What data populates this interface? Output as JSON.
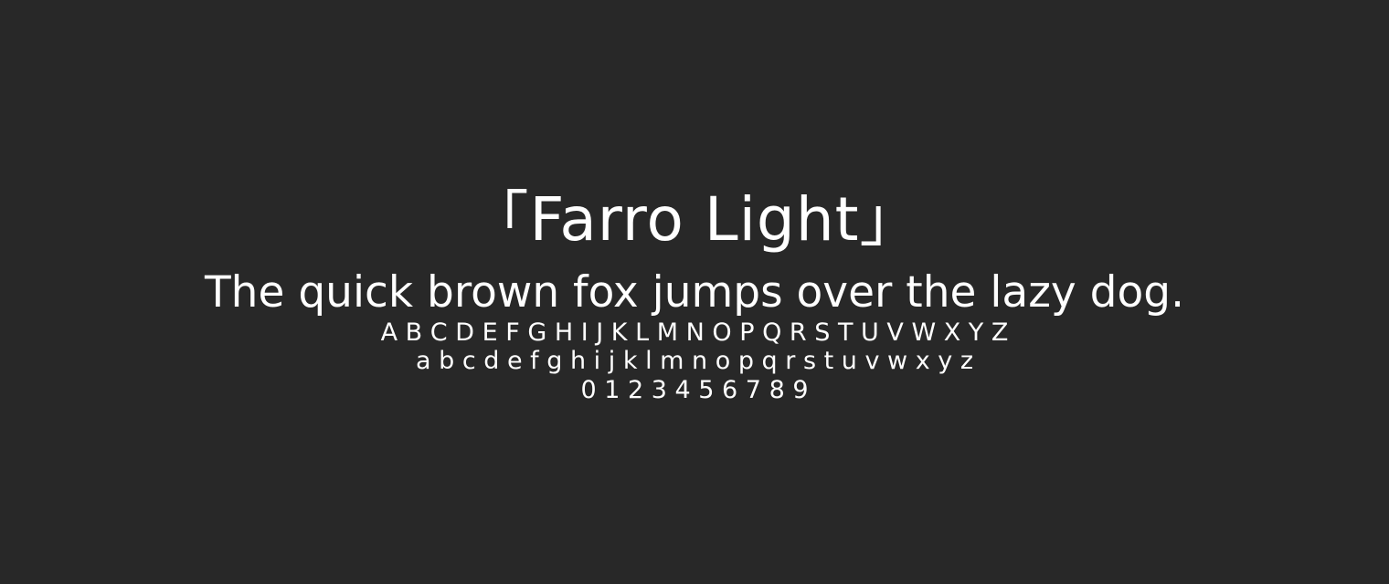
{
  "colors": {
    "background": "#282828",
    "text": "#ffffff"
  },
  "specimen": {
    "title": "「Farro Light」",
    "pangram": "The quick brown fox jumps over the lazy dog.",
    "uppercase": "A B C D E F G H I J K L M N O P Q R S T U V W X Y Z",
    "lowercase": "a b c d e f g h i j k l m n o p q r s t u v w x y z",
    "digits": "0 1 2 3 4 5 6 7 8 9"
  }
}
